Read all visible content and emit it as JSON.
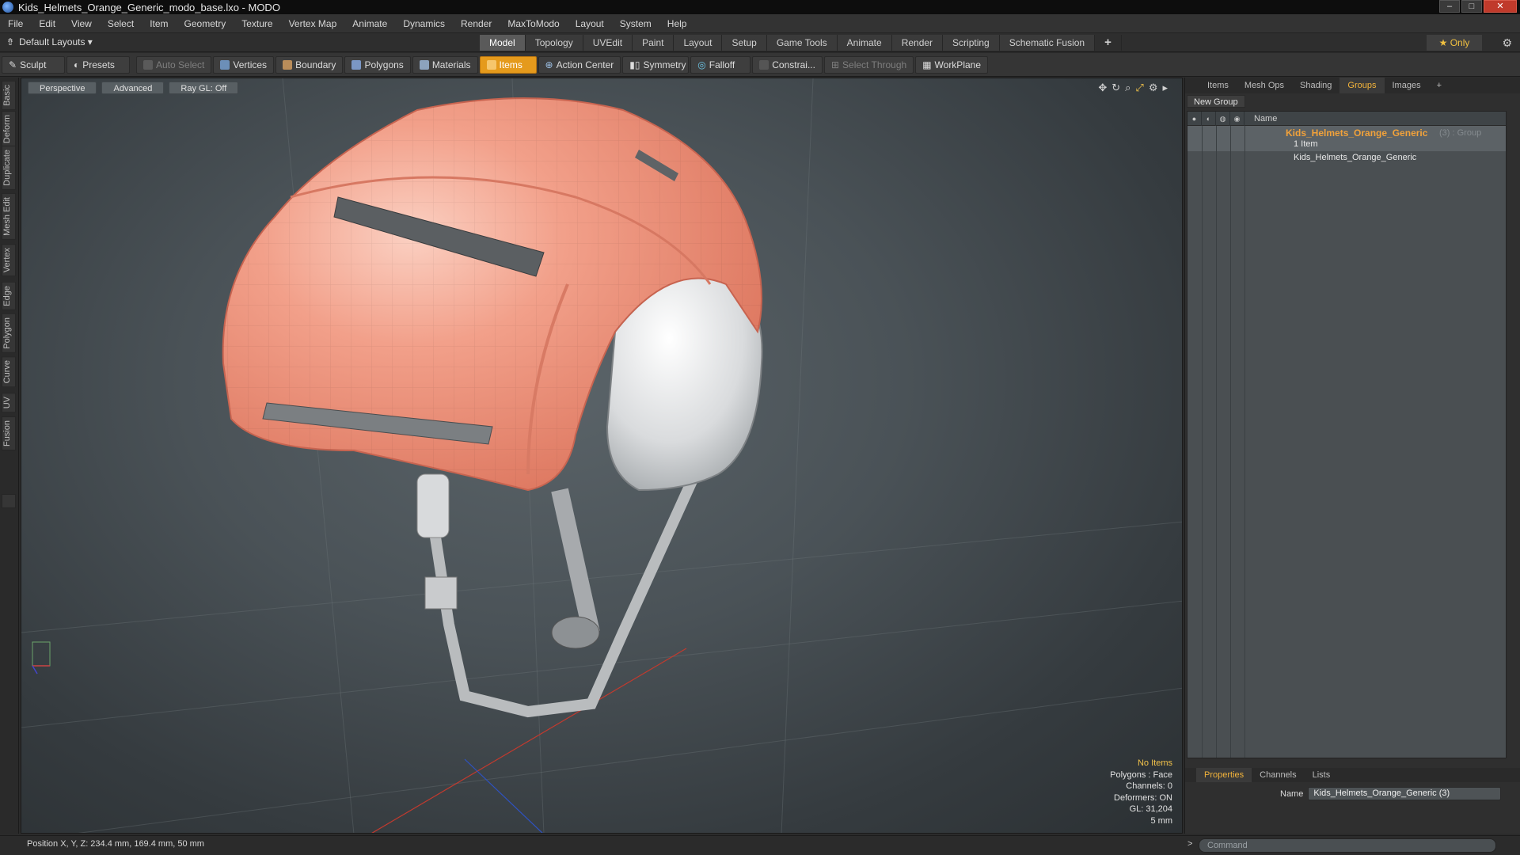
{
  "window": {
    "title": "Kids_Helmets_Orange_Generic_modo_base.lxo - MODO"
  },
  "menu": [
    "File",
    "Edit",
    "View",
    "Select",
    "Item",
    "Geometry",
    "Texture",
    "Vertex Map",
    "Animate",
    "Dynamics",
    "Render",
    "MaxToModo",
    "Layout",
    "System",
    "Help"
  ],
  "layouts": {
    "label": "Default Layouts ▾"
  },
  "layout_tabs": [
    "Model",
    "Topology",
    "UVEdit",
    "Paint",
    "Layout",
    "Setup",
    "Game Tools",
    "Animate",
    "Render",
    "Scripting",
    "Schematic Fusion"
  ],
  "layout_only": "★  Only",
  "toolbar": {
    "sculpt": "Sculpt",
    "presets": "Presets",
    "auto_select": "Auto Select",
    "vertices": "Vertices",
    "boundary": "Boundary",
    "polygons": "Polygons",
    "materials": "Materials",
    "items": "Items",
    "action_center": "Action Center",
    "symmetry": "Symmetry",
    "falloff": "Falloff",
    "constraints": "Constrai...",
    "select_through": "Select Through",
    "workplane": "WorkPlane"
  },
  "left_tabs": [
    "Basic",
    "Deform",
    "Duplicate",
    "Mesh Edit",
    "Vertex",
    "Edge",
    "Polygon",
    "Curve",
    "UV",
    "Fusion"
  ],
  "viewport": {
    "view": "Perspective",
    "shading": "Advanced",
    "raygl": "Ray GL: Off",
    "info": {
      "no_items": "No Items",
      "polygons": "Polygons : Face",
      "channels": "Channels: 0",
      "deformers": "Deformers: ON",
      "gl": "GL: 31,204",
      "unit": "5 mm"
    }
  },
  "right_panel": {
    "tabs": [
      "Items",
      "Mesh Ops",
      "Shading",
      "Groups",
      "Images"
    ],
    "active_tab": "Groups",
    "new_group": "New Group",
    "name_header": "Name",
    "group": {
      "name": "Kids_Helmets_Orange_Generic",
      "meta": "(3) : Group",
      "count": "1 Item"
    },
    "item": {
      "name": "Kids_Helmets_Orange_Generic"
    },
    "bottom_tabs": [
      "Properties",
      "Channels",
      "Lists"
    ],
    "name_label": "Name",
    "name_value": "Kids_Helmets_Orange_Generic (3)"
  },
  "status": {
    "position": "Position X, Y, Z:   234.4 mm, 169.4 mm, 50 mm"
  },
  "command": {
    "placeholder": "Command"
  },
  "colors": {
    "accent": "#e59a1c",
    "helmet": "#e98a73",
    "tab_active": "#f2b33a"
  }
}
